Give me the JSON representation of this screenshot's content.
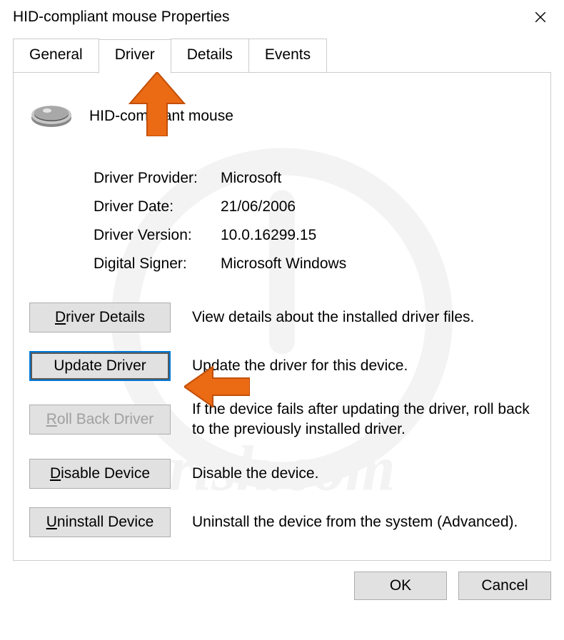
{
  "window": {
    "title": "HID-compliant mouse Properties"
  },
  "tabs": [
    "General",
    "Driver",
    "Details",
    "Events"
  ],
  "active_tab": "Driver",
  "device": {
    "name": "HID-compliant mouse"
  },
  "info": {
    "provider_label": "Driver Provider:",
    "provider_value": "Microsoft",
    "date_label": "Driver Date:",
    "date_value": "21/06/2006",
    "version_label": "Driver Version:",
    "version_value": "10.0.16299.15",
    "signer_label": "Digital Signer:",
    "signer_value": "Microsoft Windows"
  },
  "actions": {
    "details": {
      "label": "Driver Details",
      "prefix": "D",
      "rest": "river Details",
      "desc": "View details about the installed driver files."
    },
    "update": {
      "label": "Update Driver",
      "desc": "Update the driver for this device."
    },
    "rollback": {
      "prefix": "R",
      "rest": "oll Back Driver",
      "desc": "If the device fails after updating the driver, roll back to the previously installed driver."
    },
    "disable": {
      "prefix": "D",
      "rest": "isable Device",
      "desc": "Disable the device."
    },
    "uninstall": {
      "prefix": "U",
      "rest": "ninstall Device",
      "desc": "Uninstall the device from the system (Advanced)."
    }
  },
  "buttons": {
    "ok": "OK",
    "cancel": "Cancel"
  },
  "watermark": "PCrisk.com"
}
